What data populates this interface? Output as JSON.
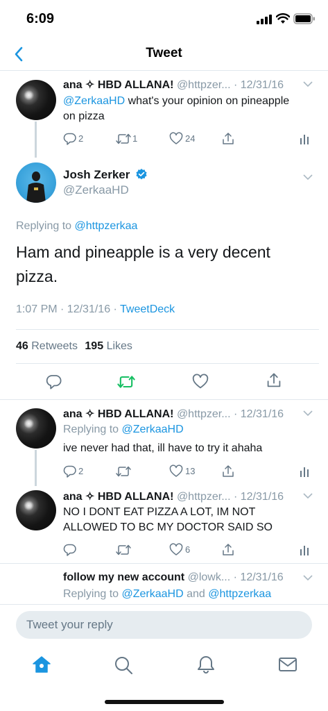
{
  "status_bar": {
    "time": "6:09"
  },
  "nav": {
    "title": "Tweet"
  },
  "tweet1": {
    "name": "ana ✧ HBD ALLANA!",
    "handle": "@httpzer...",
    "date": "· 12/31/16",
    "mention": "@ZerkaaHD",
    "text_line1": " what's your opinion on pineapple",
    "text_line2": "on pizza",
    "replies": "2",
    "retweets": "1",
    "likes": "24"
  },
  "main_tweet": {
    "name": "Josh Zerker",
    "handle": "@ZerkaaHD",
    "replying_prefix": "Replying to ",
    "replying_handle": "@httpzerkaa",
    "text_line1": "Ham and pineapple is a very decent",
    "text_line2": "pizza.",
    "timestamp": "1:07 PM · 12/31/16 · ",
    "source": "TweetDeck",
    "retweets_count": "46",
    "retweets_label": "Retweets",
    "likes_count": "195",
    "likes_label": "Likes"
  },
  "reply1": {
    "name": "ana ✧ HBD ALLANA!",
    "handle": "@httpzer...",
    "date": "· 12/31/16",
    "replying_prefix": "Replying to ",
    "replying_handle": "@ZerkaaHD",
    "text": "ive never had that, ill have to try it ahaha",
    "replies": "2",
    "retweets": "",
    "likes": "13"
  },
  "reply2": {
    "name": "ana ✧ HBD ALLANA!",
    "handle": "@httpzer...",
    "date": "· 12/31/16",
    "text_line1": "NO I DONT EAT PIZZA A LOT, IM NOT",
    "text_line2": "ALLOWED TO BC MY DOCTOR SAID SO",
    "replies": "",
    "retweets": "",
    "likes": "6"
  },
  "reply3": {
    "name": "follow my new account",
    "handle": "@lowk...",
    "date": "· 12/31/16",
    "replying_prefix": "Replying to ",
    "replying_handle1": "@ZerkaaHD",
    "replying_and": " and ",
    "replying_handle2": "@httpzerkaa"
  },
  "reply_input": {
    "placeholder": "Tweet your reply"
  },
  "tabbar": {
    "items": [
      "home-icon",
      "search-icon",
      "notifications-icon",
      "messages-icon"
    ]
  },
  "colors": {
    "accent": "#1b95e0",
    "retweet_green": "#17bf63",
    "muted": "#8899a6"
  }
}
